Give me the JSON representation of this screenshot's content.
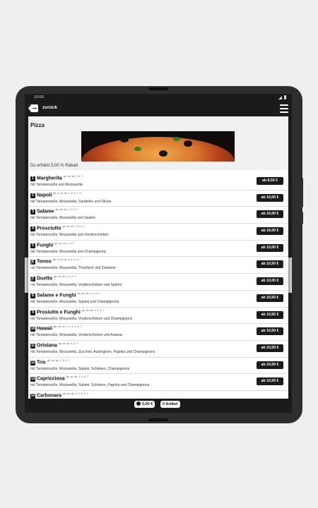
{
  "status": {
    "time": "10:00"
  },
  "appbar": {
    "back_label": "zurück"
  },
  "category": {
    "title": "Pizza",
    "discount_text": "Du erhälst 5,00 % Rabatt."
  },
  "items": [
    {
      "num": "1",
      "name": "Margherita",
      "codes": "gh, sd, wt, 1, 4, 7",
      "desc": "mit Tomatensoße und Mozzarella",
      "price": "ab 8,50 €"
    },
    {
      "num": "2",
      "name": "Napoli",
      "codes": "gh, fi, sd, wt, 1, 3, 4, 7, 9",
      "desc": "mit Tomatensoße, Mozzarella, Sardellen und Oliven",
      "price": "ab 10,00 €"
    },
    {
      "num": "3",
      "name": "Salame",
      "codes": "gh, sd, wt, 1, 3, 4, 7",
      "desc": "mit Tomatensoße, Mozzarella und Salami",
      "price": "ab 10,00 €"
    },
    {
      "num": "4",
      "name": "Prosciutto",
      "codes": "gh, sd, wt, 1, 3, 4, 7",
      "desc": "mit Tomatensoße, Mozzarella und Vorderschinken",
      "price": "ab 10,00 €"
    },
    {
      "num": "5",
      "name": "Funghi",
      "codes": "gh, sd, wt, 1, 4, 7",
      "desc": "mit Tomatensoße, Mozzarella und Champignons",
      "price": "ab 10,00 €"
    },
    {
      "num": "6",
      "name": "Tonno",
      "codes": "gh, fi, sd, wt, 1, 2, 3, 4, 7",
      "desc": "mit Tomatensoße, Mozzarella, Thunfisch und Zwiebeln",
      "price": "ab 10,50 €"
    },
    {
      "num": "7",
      "name": "Duetto",
      "codes": "gh, sd, wt, 1, 3, 4, 7",
      "desc": "mit Tomatensoße, Mozzarella, Vorderschinken und Salami",
      "price": "ab 10,00 €"
    },
    {
      "num": "8",
      "name": "Salame e Funghi",
      "codes": "gh, sd, wt, 1, 3, 4, 7",
      "desc": "mit Tomatensoße, Mozzarella, Salami und Champignons",
      "price": "ab 10,50 €"
    },
    {
      "num": "9",
      "name": "Prosiutto e Funghi",
      "codes": "gh, sd, wt, 1, 3, 4, 7",
      "desc": "mit Tomatensoße, Mozzarella, Vorderschinken und Champignons",
      "price": "ab 10,50 €"
    },
    {
      "num": "10",
      "name": "Hawaii",
      "codes": "gh, sd, wt, 1, 2, 3, 4, 6, 7",
      "desc": "mit Tomatensoße, Mozzarella, Vorderschinken und Ananas",
      "price": "ab 10,50 €"
    },
    {
      "num": "11",
      "name": "Ortolana",
      "codes": "gh, sd, wt, 1, 4, 7",
      "desc": "mit Tomatensoße, Mozzarella, Zucchini, Auberginen, Paprika und Champignons",
      "price": "ab 10,50 €"
    },
    {
      "num": "12",
      "name": "Trio",
      "codes": "gh, sd, wt, 1, 3, 4, 7",
      "desc": "mit Tomatensoße, Mozzarella, Salami, Schinken, Champignons",
      "price": "ab 10,50 €"
    },
    {
      "num": "13",
      "name": "Capricciosa",
      "codes": "gh, sd, wt, 1, 3, 4, 7",
      "desc": "mit Tomatensoße, Mozzarella, Salami, Schinken, Paprika und Champignons",
      "price": "ab 10,50 €"
    },
    {
      "num": "14",
      "name": "Carbonara",
      "codes": "gh, sd, wt, 1, 2, 3, 4, 7",
      "desc": "",
      "price": ""
    }
  ],
  "cart": {
    "total": "0,00 €",
    "count": "0 Artikel"
  }
}
